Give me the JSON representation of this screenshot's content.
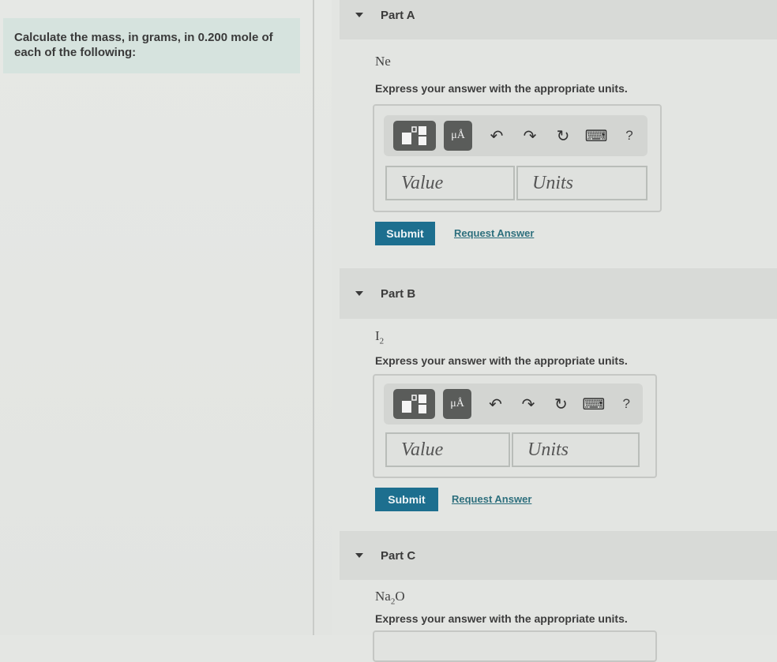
{
  "problem": {
    "intro": "Calculate the mass, in grams, in 0.200 mole of each of the following:"
  },
  "toolbar": {
    "template_icon": "fraction-template-icon",
    "units_label": "μÅ",
    "undo_icon": "↶",
    "redo_icon": "↷",
    "reset_icon": "↻",
    "keyboard_icon": "⌨",
    "help_label": "?"
  },
  "parts": [
    {
      "title": "Part A",
      "formula_main": "Ne",
      "formula_sub": "",
      "formula_tail": "",
      "instruction": "Express your answer with the appropriate units.",
      "value_placeholder": "Value",
      "units_placeholder": "Units",
      "submit_label": "Submit",
      "request_label": "Request Answer"
    },
    {
      "title": "Part B",
      "formula_main": "I",
      "formula_sub": "2",
      "formula_tail": "",
      "instruction": "Express your answer with the appropriate units.",
      "value_placeholder": "Value",
      "units_placeholder": "Units",
      "submit_label": "Submit",
      "request_label": "Request Answer"
    },
    {
      "title": "Part C",
      "formula_main": "Na",
      "formula_sub": "2",
      "formula_tail": "O",
      "instruction": "Express your answer with the appropriate units."
    }
  ]
}
